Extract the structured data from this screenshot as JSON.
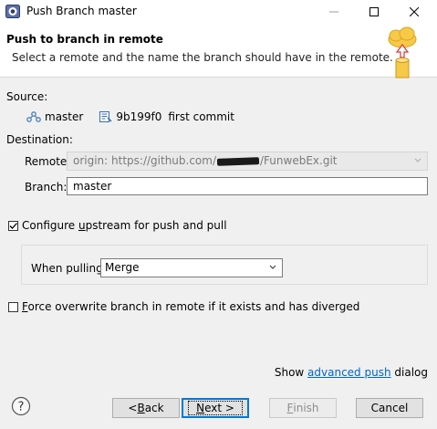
{
  "window": {
    "title": "Push Branch master"
  },
  "banner": {
    "title": "Push to branch in remote",
    "description": "Select a remote and the name the branch should have in the remote."
  },
  "source": {
    "label": "Source:",
    "branch": "master",
    "commit_id": "9b199f0",
    "commit_message": "first commit"
  },
  "destination": {
    "label": "Destination:",
    "remote_label": "Remote:",
    "remote_prefix": "origin: https://github.com/",
    "remote_suffix": "/FunwebEx.git",
    "branch_label": "Branch:",
    "branch_value": "master"
  },
  "upstream": {
    "checked": true,
    "label_pre": "Configure ",
    "label_mnemonic": "u",
    "label_post": "pstream for push and pull",
    "pulling_label": "When pulling:",
    "pulling_value": "Merge"
  },
  "force": {
    "checked": false,
    "label_mnemonic": "F",
    "label_post": "orce overwrite branch in remote if it exists and has diverged"
  },
  "advanced": {
    "pre": "Show ",
    "link": "advanced push",
    "post": " dialog"
  },
  "buttons": {
    "back_pre": "< ",
    "back_mnemonic": "B",
    "back_post": "ack",
    "next_mnemonic": "N",
    "next_post": "ext >",
    "finish_mnemonic": "F",
    "finish_post": "inish",
    "cancel": "Cancel"
  },
  "icons": {
    "app": "eclipse-icon",
    "help": "help-icon",
    "banner": "cloud-push-icon"
  },
  "colors": {
    "link": "#0066cc",
    "focus": "#0078d7",
    "banner_cloud": "#f7c948"
  }
}
